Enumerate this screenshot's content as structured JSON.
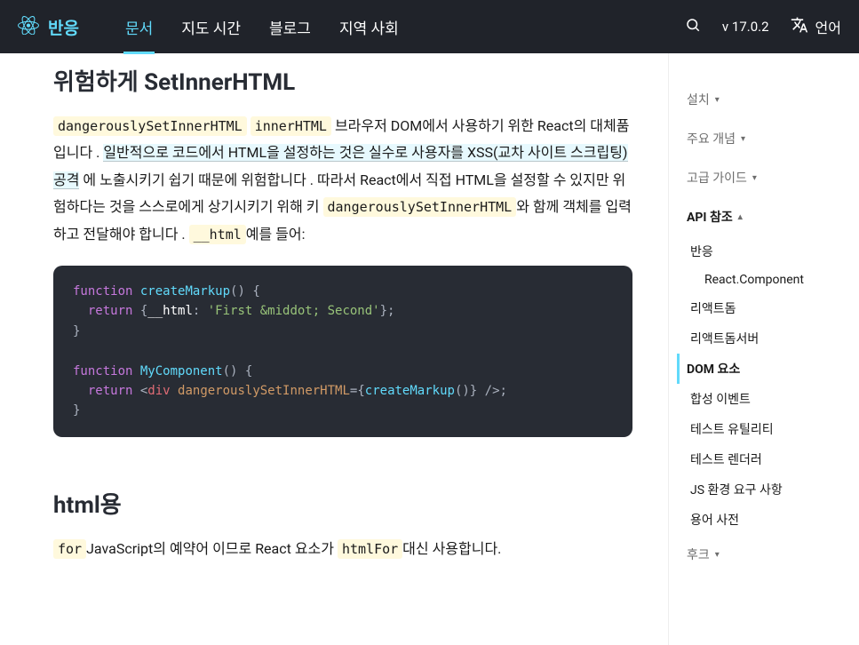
{
  "header": {
    "brand": "반응",
    "nav": [
      "문서",
      "지도 시간",
      "블로그",
      "지역 사회"
    ],
    "active_nav_index": 0,
    "version": "v 17.0.2",
    "language": "언어"
  },
  "content": {
    "section1": {
      "heading": "위험하게 SetInnerHTML",
      "p1_code1": "dangerouslySetInnerHTML",
      "p1_code2": "innerHTML",
      "p1_t1": "브라우저 DOM에서 사용하기 위한 React의 대체품입니다 . ",
      "p1_link": "일반적으로 코드에서 HTML을 설정하는 것은 실수로 사용자를 XSS(교차 사이트 스크립팅) 공격",
      "p1_t2": " 에 노출시키기 쉽기 때문에 위험합니다 . 따라서 React에서 직접 HTML을 설정할 수 있지만 위험하다는 것을 스스로에게 상기시키기 위해 키 ",
      "p1_code3": "dangerouslySetInnerHTML",
      "p1_t3": "와 함께 객체를 입력하고 전달해야 합니다 . ",
      "p1_code4": "__html",
      "p1_t4": "예를 들어:",
      "code": {
        "l1_kw": "function",
        "l1_fn": "createMarkup",
        "l1_rest": "() {",
        "l2_kw": "return",
        "l2_brace": " {",
        "l2_prop": "__html",
        "l2_colon": ": ",
        "l2_str": "'First &middot; Second'",
        "l2_end": "};",
        "l3": "}",
        "l5_kw": "function",
        "l5_fn": "MyComponent",
        "l5_rest": "() {",
        "l6_kw": "return",
        "l6_open": " <",
        "l6_tag": "div",
        "l6_attr": "dangerouslySetInnerHTML",
        "l6_eq": "=",
        "l6_b1": "{",
        "l6_call": "createMarkup",
        "l6_paren": "()",
        "l6_b2": "}",
        "l6_close": " />;",
        "l7": "}"
      }
    },
    "section2": {
      "heading": "html용",
      "p_code1": "for",
      "p_t1": "JavaScript의 예약어 이므로 React 요소가 ",
      "p_code2": "htmlFor",
      "p_t2": "대신 사용합니다."
    }
  },
  "sidebar": {
    "groups": [
      {
        "label": "설치",
        "expanded": false
      },
      {
        "label": "주요 개념",
        "expanded": false
      },
      {
        "label": "고급 가이드",
        "expanded": false
      }
    ],
    "api_group": "API 참조",
    "api_links": [
      {
        "label": "반응",
        "sub": false,
        "active": false
      },
      {
        "label": "React.Component",
        "sub": true,
        "active": false
      },
      {
        "label": "리액트돔",
        "sub": false,
        "active": false
      },
      {
        "label": "리액트돔서버",
        "sub": false,
        "active": false
      },
      {
        "label": "DOM 요소",
        "sub": false,
        "active": true
      },
      {
        "label": "합성 이벤트",
        "sub": false,
        "active": false
      },
      {
        "label": "테스트 유틸리티",
        "sub": false,
        "active": false
      },
      {
        "label": "테스트 렌더러",
        "sub": false,
        "active": false
      },
      {
        "label": "JS 환경 요구 사항",
        "sub": false,
        "active": false
      },
      {
        "label": "용어 사전",
        "sub": false,
        "active": false
      }
    ],
    "bottom_group": "후크"
  }
}
